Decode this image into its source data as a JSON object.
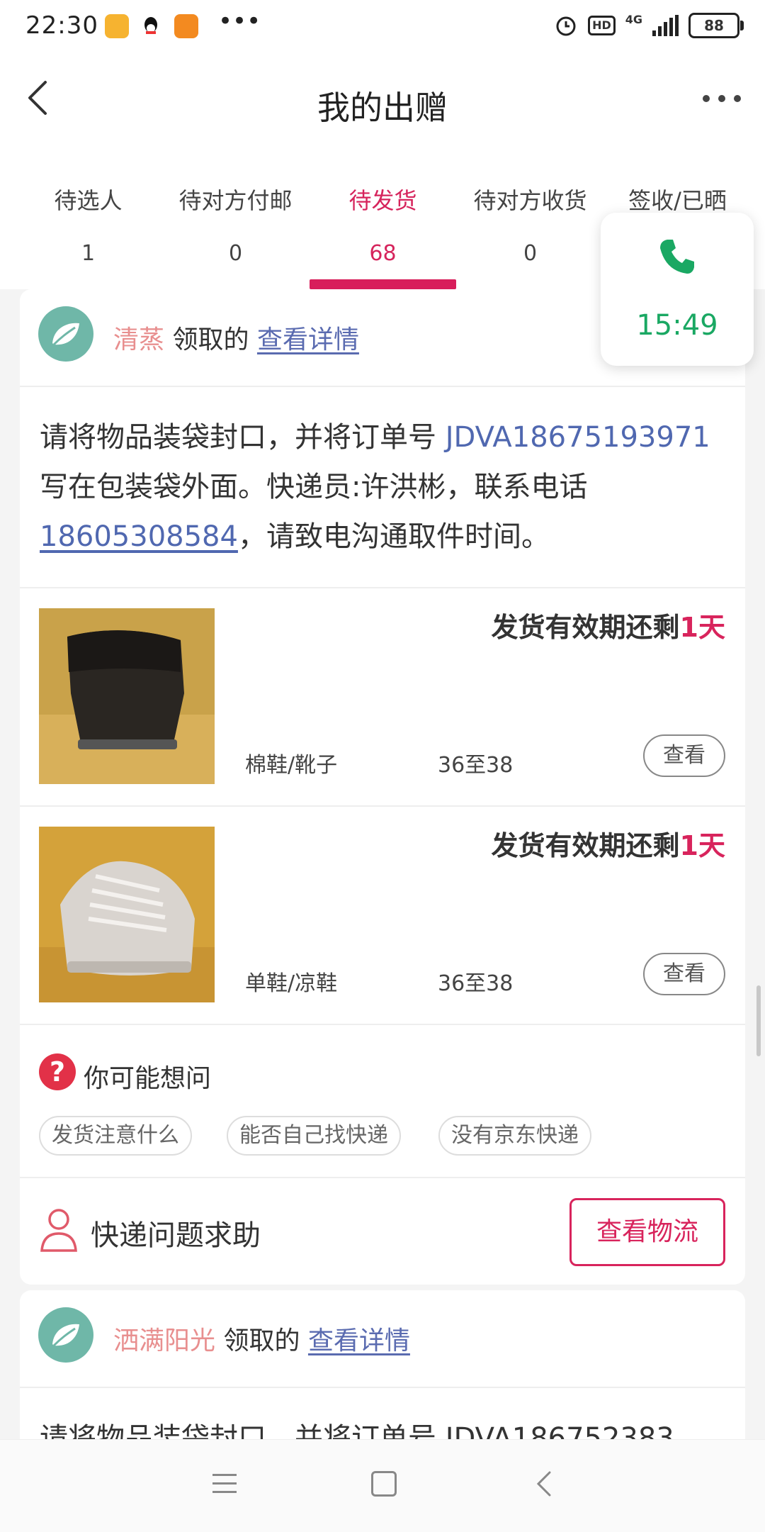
{
  "status_bar": {
    "time": "22:30",
    "dots": "•••",
    "hd": "HD",
    "network": "4G",
    "battery": "88"
  },
  "header": {
    "title": "我的出赠"
  },
  "tabs": [
    {
      "label": "待选人",
      "count": "1"
    },
    {
      "label": "待对方付邮",
      "count": "0"
    },
    {
      "label": "待发货",
      "count": "68"
    },
    {
      "label": "待对方收货",
      "count": "0"
    },
    {
      "label": "签收/已晒",
      "count": ""
    }
  ],
  "call_overlay": {
    "time": "15:49"
  },
  "cards": [
    {
      "recipient": "清蒸",
      "received_text": "领取的",
      "details_link": "查看详情",
      "notice": {
        "prefix": "请将物品装袋封口，并将订单号 ",
        "order_no": "JDVA18675193971",
        "middle": " 写在包装袋外面。快递员:许洪彬，联系电话",
        "phone": "18605308584",
        "suffix": "，请致电沟通取件时间。"
      },
      "items": [
        {
          "deadline_prefix": "发货有效期还剩",
          "deadline_days": "1天",
          "category": "棉鞋/靴子",
          "size": "36至38",
          "view_label": "查看"
        },
        {
          "deadline_prefix": "发货有效期还剩",
          "deadline_days": "1天",
          "category": "单鞋/凉鞋",
          "size": "36至38",
          "view_label": "查看"
        }
      ],
      "faq": {
        "title": "你可能想问",
        "chips": [
          "发货注意什么",
          "能否自己找快递",
          "没有京东快递"
        ]
      },
      "help": {
        "text": "快递问题求助",
        "logistics_label": "查看物流"
      }
    },
    {
      "recipient": "洒满阳光",
      "received_text": "领取的",
      "details_link": "查看详情",
      "notice_partial": "请将物品装袋封口，并将订单号 JDVA186752383"
    }
  ],
  "colors": {
    "accent": "#d8245c",
    "link": "#5068b0",
    "name": "#e88f8f",
    "call_green": "#1aa863"
  }
}
